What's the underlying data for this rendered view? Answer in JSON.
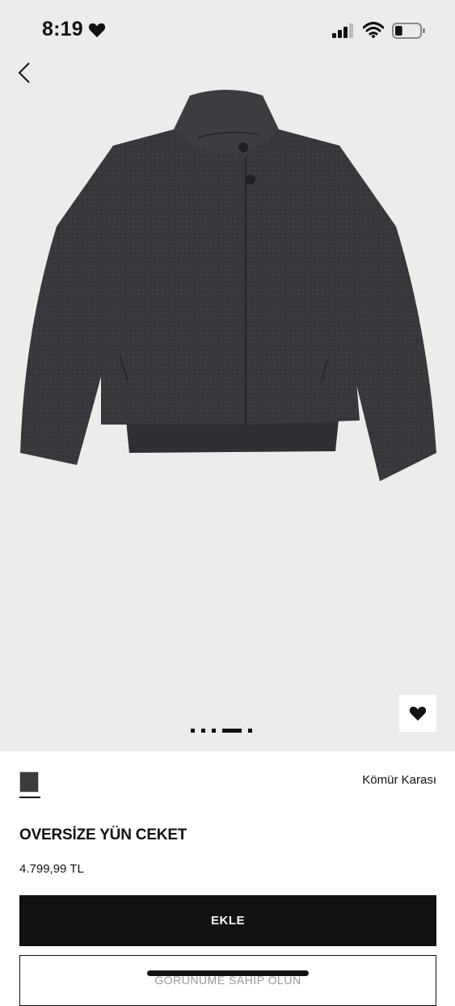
{
  "status_bar": {
    "time": "8:19",
    "battery_level": 0.3
  },
  "product": {
    "color_name": "Kömür Karası",
    "title": "OVERSİZE YÜN CEKET",
    "price": "4.799,99 TL",
    "swatch_color": "#3b3b3d"
  },
  "gallery": {
    "image_count": 5,
    "active_index": 3
  },
  "actions": {
    "add_label": "EKLE",
    "secondary_label": "GÖRÜNÜME SAHİP OLUN"
  },
  "icons": [
    "back-chevron-icon",
    "heart-icon",
    "signal-icon",
    "wifi-icon",
    "battery-icon"
  ]
}
